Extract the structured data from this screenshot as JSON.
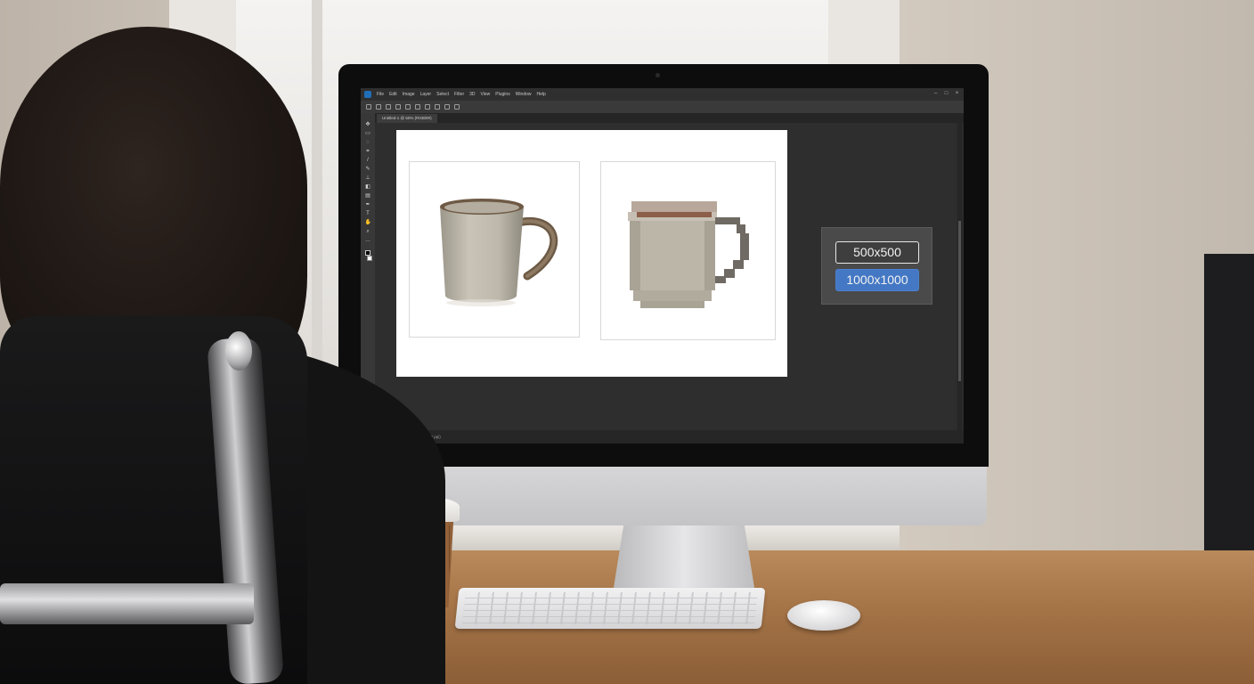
{
  "scene": "person at desk editing image",
  "app": {
    "menu": [
      "File",
      "Edit",
      "Image",
      "Layer",
      "Select",
      "Filter",
      "3D",
      "View",
      "Plugins",
      "Window",
      "Help"
    ],
    "document_tab": "Untitled-1 @ 50% (RGB/8#)",
    "statusbar_left": "50%",
    "statusbar_right": "1000 px x 500 px (72 ppi)"
  },
  "size_options": {
    "option_small": "500x500",
    "option_large": "1000x1000",
    "selected": "1000x1000"
  },
  "colors": {
    "selected_button": "#4478c4",
    "workspace": "#2e2e2e"
  },
  "icons": {
    "toolbar": [
      "move-icon",
      "marquee-icon",
      "lasso-icon",
      "crop-icon",
      "eyedropper-icon",
      "brush-icon",
      "stamp-icon",
      "eraser-icon",
      "gradient-icon",
      "pen-icon",
      "type-icon",
      "hand-icon",
      "zoom-icon"
    ]
  }
}
